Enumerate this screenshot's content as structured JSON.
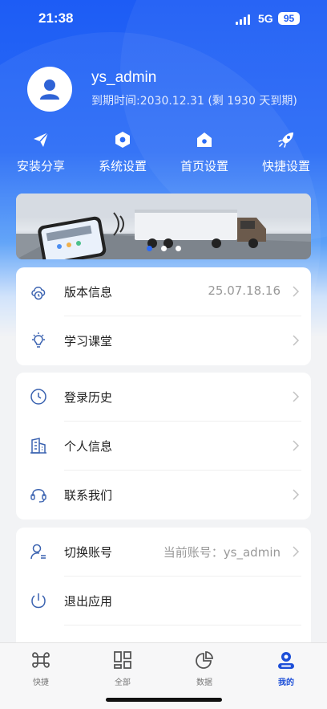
{
  "status": {
    "time": "21:38",
    "network": "5G",
    "battery": "95"
  },
  "profile": {
    "username": "ys_admin",
    "expire_text": "到期时间:2030.12.31 (剩 1930 天到期)"
  },
  "quick_actions": [
    {
      "label": "安装分享",
      "icon": "paper-plane-icon"
    },
    {
      "label": "系统设置",
      "icon": "hexagon-gear-icon"
    },
    {
      "label": "首页设置",
      "icon": "home-icon"
    },
    {
      "label": "快捷设置",
      "icon": "rocket-icon"
    }
  ],
  "banner": {
    "dots": 3,
    "active_dot": 0
  },
  "section1": [
    {
      "label": "版本信息",
      "value": "25.07.18.16",
      "icon": "cloud-clock-icon"
    },
    {
      "label": "学习课堂",
      "value": "",
      "icon": "lightbulb-icon"
    }
  ],
  "section2": [
    {
      "label": "登录历史",
      "icon": "clock-icon"
    },
    {
      "label": "个人信息",
      "icon": "building-icon"
    },
    {
      "label": "联系我们",
      "icon": "headset-icon"
    }
  ],
  "section3": [
    {
      "label": "切换账号",
      "value": "当前账号：ys_admin",
      "icon": "user-switch-icon"
    },
    {
      "label": "退出应用",
      "value": "",
      "icon": "power-icon"
    }
  ],
  "tabs": [
    {
      "label": "快捷",
      "icon": "command-icon"
    },
    {
      "label": "全部",
      "icon": "grid-icon"
    },
    {
      "label": "数据",
      "icon": "pie-chart-icon"
    },
    {
      "label": "我的",
      "icon": "user-icon",
      "active": true
    }
  ],
  "colors": {
    "primary": "#1d5cf5",
    "tab_active": "#1d4fd8",
    "icon_blue": "#3a62b0"
  }
}
